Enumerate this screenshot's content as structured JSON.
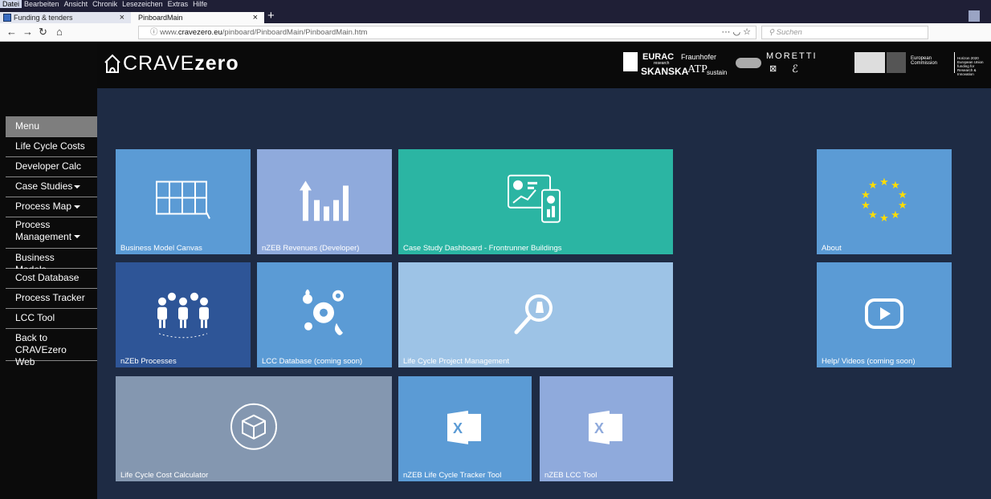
{
  "browser": {
    "menu": [
      "Datei",
      "Bearbeiten",
      "Ansicht",
      "Chronik",
      "Lesezeichen",
      "Extras",
      "Hilfe"
    ],
    "tabs": [
      {
        "title": "Funding & tenders"
      },
      {
        "title": "PinboardMain"
      }
    ],
    "url": {
      "prefix": "www.",
      "domain": "cravezero.eu",
      "path": "/pinboard/PinboardMain/PinboardMain.htm"
    },
    "search_placeholder": "Suchen"
  },
  "site": {
    "logo_prefix": "CRAVE",
    "logo_suffix": "zero",
    "partners": {
      "eurac": "EURAC",
      "eurac_sub": "research",
      "fraunhofer": "Fraunhofer",
      "moretti": "MORETTI",
      "skanska": "SKANSKA",
      "sustain": "sustain",
      "ec": "European Commission",
      "horizon": "Horizon 2020 European Union funding for Research & Innovation"
    }
  },
  "menu": {
    "title": "Menu",
    "items": [
      {
        "label": "Life Cycle Costs"
      },
      {
        "label": "Developer Calc"
      },
      {
        "label": "Case Studies",
        "dropdown": true
      },
      {
        "label": "Process Map",
        "dropdown": true
      },
      {
        "label": "Process Management",
        "dropdown": true
      },
      {
        "label": "Business Models"
      },
      {
        "label": "Cost Database"
      },
      {
        "label": "Process Tracker"
      },
      {
        "label": "LCC Tool"
      },
      {
        "label": "Back to CRAVEzero Web"
      }
    ]
  },
  "tiles": [
    {
      "label": "Business Model Canvas",
      "color": "#5b9bd5",
      "icon": "canvas-icon"
    },
    {
      "label": "nZEB Revenues (Developer)",
      "color": "#8faadc",
      "icon": "revenue-chart-icon"
    },
    {
      "label": "Case Study Dashboard - Frontrunner Buildings",
      "color": "#2bb5a3",
      "icon": "dashboard-icon"
    },
    {
      "label": "About",
      "color": "#5b9bd5",
      "icon": "eu-stars-icon"
    },
    {
      "label": "nZEb Processes",
      "color": "#2e5597",
      "icon": "team-icon"
    },
    {
      "label": "LCC Database (coming soon)",
      "color": "#5b9bd5",
      "icon": "gears-icon"
    },
    {
      "label": "Life Cycle Project Management",
      "color": "#9dc3e6",
      "icon": "magnifier-icon"
    },
    {
      "label": "Help/ Videos (coming soon)",
      "color": "#5b9bd5",
      "icon": "play-icon"
    },
    {
      "label": "Life Cycle Cost Calculator",
      "color": "#8497b0",
      "icon": "cube-cycle-icon"
    },
    {
      "label": "nZEB Life Cycle Tracker Tool",
      "color": "#5b9bd5",
      "icon": "excel-icon"
    },
    {
      "label": "nZEB LCC Tool",
      "color": "#8faadc",
      "icon": "excel-icon"
    }
  ]
}
